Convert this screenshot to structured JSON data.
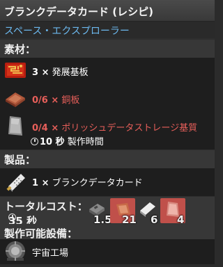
{
  "title": "ブランクデータカード (レシピ)",
  "category": "スペース・エクスプローラー",
  "ingredients": {
    "header": "素材：",
    "items": [
      {
        "qty": "3 ×",
        "name": "発展基板",
        "color": "#ffffff",
        "icon": "advanced-circuit-icon"
      },
      {
        "qty": "0/6 ×",
        "name": "銅板",
        "color": "#e85f5a",
        "icon": "copper-plate-icon"
      },
      {
        "qty": "0/4 ×",
        "name": "ポリッシュデータストレージ基質",
        "color": "#e85f5a",
        "icon": "data-storage-substrate-icon"
      }
    ],
    "time_value": "10 秒",
    "time_label": "製作時間"
  },
  "products": {
    "header": "製品：",
    "items": [
      {
        "qty": "1 ×",
        "name": "ブランクデータカード",
        "icon": "blank-data-card-icon"
      }
    ]
  },
  "total_cost": {
    "header": "トータルコスト：",
    "time": "35 秒",
    "items": [
      {
        "icon": "stone-tablet-icon",
        "count": "1.5"
      },
      {
        "icon": "copper-plate-icon",
        "count": "21"
      },
      {
        "icon": "white-card-icon",
        "count": "6"
      },
      {
        "icon": "red-card-icon",
        "count": "4"
      }
    ]
  },
  "made_in": {
    "header": "製作可能設備：",
    "items": [
      {
        "name": "宇宙工場",
        "icon": "space-factory-icon"
      }
    ]
  }
}
